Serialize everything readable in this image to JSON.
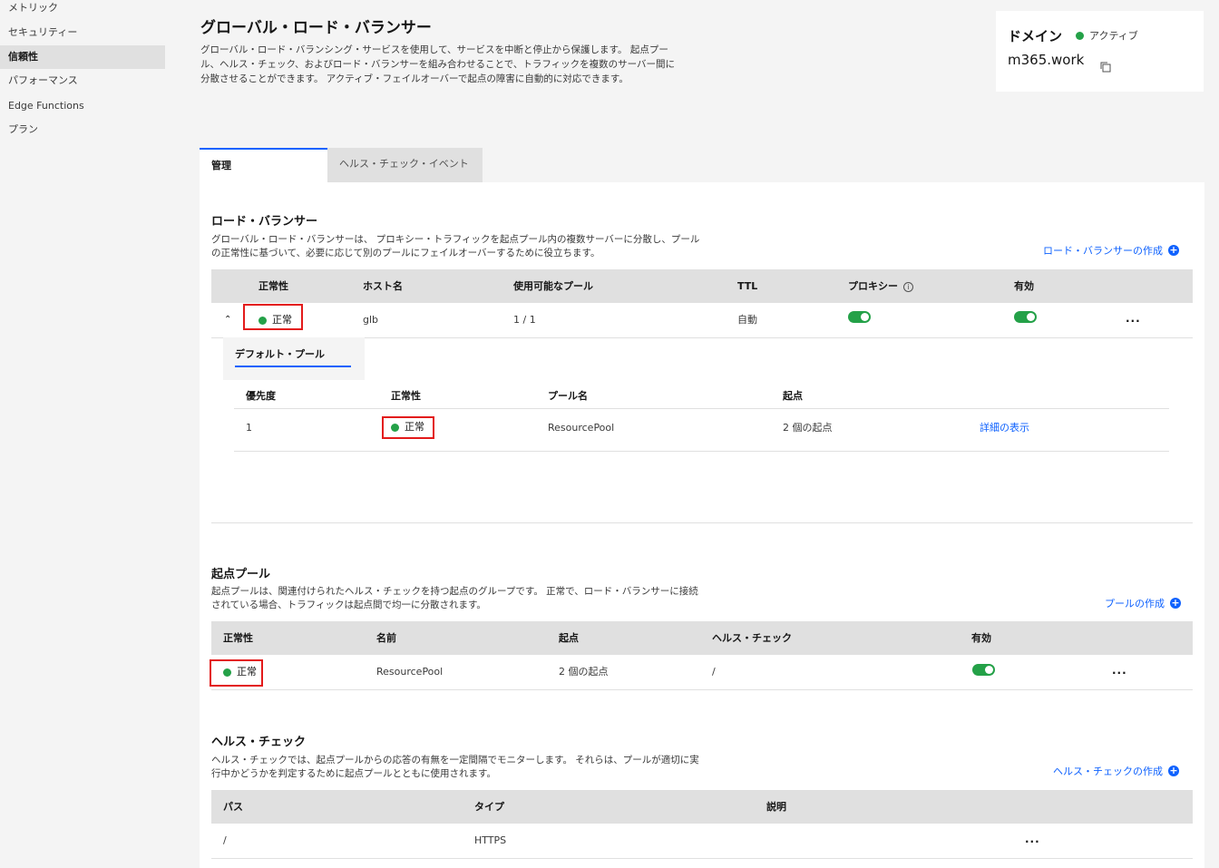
{
  "sidebar": {
    "items": [
      {
        "label": "メトリック"
      },
      {
        "label": "セキュリティー"
      },
      {
        "label": "信頼性"
      },
      {
        "label": "パフォーマンス"
      },
      {
        "label": "Edge Functions"
      },
      {
        "label": "プラン"
      }
    ],
    "active_index": 2
  },
  "header": {
    "title": "グローバル・ロード・バランサー",
    "description": "グローバル・ロード・バランシング・サービスを使用して、サービスを中断と停止から保護します。 起点プール、ヘルス・チェック、およびロード・バランサーを組み合わせることで、トラフィックを複数のサーバー間に分散させることができます。 アクティブ・フェイルオーバーで起点の障害に自動的に対応できます。"
  },
  "domain_card": {
    "label": "ドメイン",
    "status": "アクティブ",
    "name": "m365.work"
  },
  "tabs": [
    {
      "label": "管理"
    },
    {
      "label": "ヘルス・チェック・イベント"
    }
  ],
  "load_balancers": {
    "title": "ロード・バランサー",
    "description": "グローバル・ロード・バランサーは、 プロキシー・トラフィックを起点プール内の複数サーバーに分散し、プールの正常性に基づいて、必要に応じて別のプールにフェイルオーバーするために役立ちます。",
    "create_label": "ロード・バランサーの作成",
    "columns": [
      "正常性",
      "ホスト名",
      "使用可能なプール",
      "TTL",
      "プロキシー",
      "有効"
    ],
    "rows": [
      {
        "health": "正常",
        "host": "glb",
        "pools": "1 / 1",
        "ttl": "自動",
        "proxy": true,
        "enabled": true,
        "overflow": "..."
      }
    ],
    "detail": {
      "tab_label": "デフォルト・プール",
      "columns": [
        "優先度",
        "正常性",
        "プール名",
        "起点"
      ],
      "rows": [
        {
          "priority": "1",
          "health": "正常",
          "pool_name": "ResourcePool",
          "origins": "2 個の起点",
          "link": "詳細の表示"
        }
      ]
    }
  },
  "origin_pools": {
    "title": "起点プール",
    "description": "起点プールは、関連付けられたヘルス・チェックを持つ起点のグループです。 正常で、ロード・バランサーに接続されている場合、トラフィックは起点間で均一に分散されます。",
    "create_label": "プールの作成",
    "columns": [
      "正常性",
      "名前",
      "起点",
      "ヘルス・チェック",
      "有効"
    ],
    "rows": [
      {
        "health": "正常",
        "name": "ResourcePool",
        "origins": "2 個の起点",
        "health_check": "/",
        "enabled": true,
        "overflow": "..."
      }
    ]
  },
  "health_checks": {
    "title": "ヘルス・チェック",
    "description": "ヘルス・チェックでは、起点プールからの応答の有無を一定間隔でモニターします。 それらは、プールが適切に実行中かどうかを判定するために起点プールとともに使用されます。",
    "create_label": "ヘルス・チェックの作成",
    "columns": [
      "パス",
      "タイプ",
      "説明"
    ],
    "rows": [
      {
        "path": "/",
        "type": "HTTPS",
        "description": "",
        "overflow": "..."
      }
    ]
  },
  "colors": {
    "accent": "#0f62fe",
    "success": "#24a148",
    "highlight": "#e31a1a"
  }
}
